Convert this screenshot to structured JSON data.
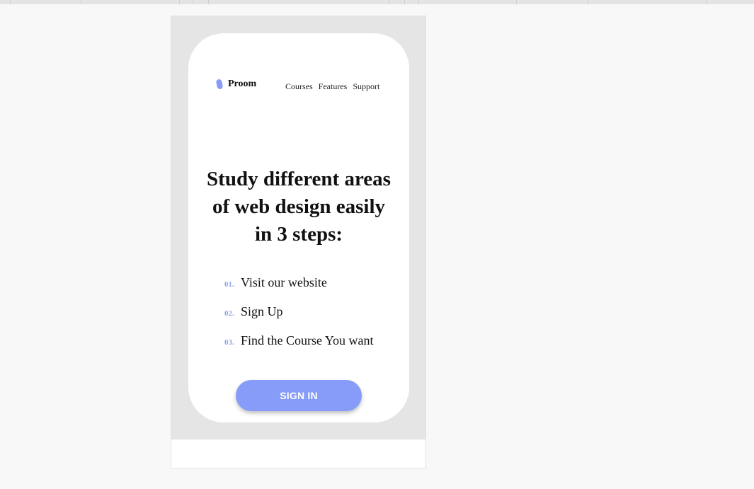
{
  "brand": {
    "name": "Proom",
    "logo_icon": "droplet-logo-icon",
    "accent_color": "#869cf8"
  },
  "nav": {
    "items": [
      "Courses",
      "Features",
      "Support"
    ]
  },
  "hero": {
    "headline_lines": [
      "Study different areas",
      "of web design easily",
      "in 3 steps:"
    ]
  },
  "steps": [
    {
      "num": "01.",
      "text": "Visit our website"
    },
    {
      "num": "02.",
      "text": "Sign Up"
    },
    {
      "num": "03.",
      "text": "Find the Course You want"
    }
  ],
  "cta": {
    "label": "SIGN IN"
  }
}
